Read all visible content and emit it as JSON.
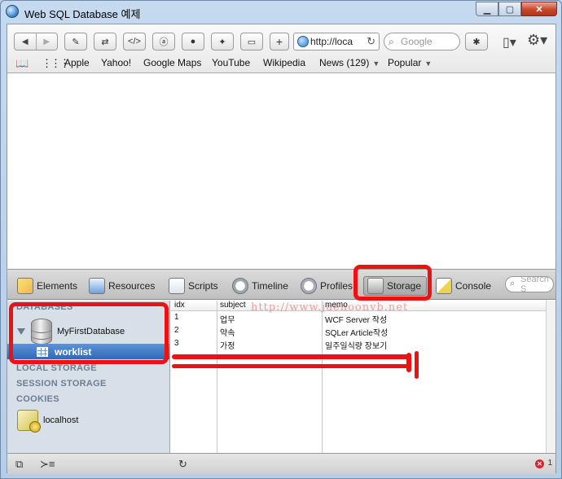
{
  "window": {
    "title": "Web SQL Database 예제"
  },
  "toolbar": {
    "url": "http://loca",
    "search_placeholder": "Google"
  },
  "bookmarks": {
    "items": [
      "Apple",
      "Yahoo!",
      "Google Maps",
      "YouTube",
      "Wikipedia"
    ],
    "news": "News (129)",
    "popular": "Popular"
  },
  "inspector": {
    "tabs": [
      "Elements",
      "Resources",
      "Scripts",
      "Timeline",
      "Profiles",
      "Storage",
      "Console"
    ],
    "active_tab": "Storage",
    "search_placeholder": "Search S"
  },
  "sidebar": {
    "databases_header": "DATABASES",
    "database_name": "MyFirstDatabase",
    "table_name": "worklist",
    "local_storage": "LOCAL STORAGE",
    "session_storage": "SESSION STORAGE",
    "cookies": "COOKIES",
    "cookie_host": "localhost"
  },
  "grid": {
    "columns": [
      "idx",
      "subject",
      "memo"
    ],
    "rows": [
      [
        "1",
        "업무",
        "WCF Server 작성"
      ],
      [
        "2",
        "약속",
        "SQLer Article작성"
      ],
      [
        "3",
        "가정",
        "일주일식량 장보기"
      ]
    ],
    "watermark": "http://www.jaehoonvb.net"
  },
  "status": {
    "error_count": "1"
  },
  "icons": [
    "back-icon",
    "forward-icon",
    "css-icon",
    "html-icon",
    "code-icon",
    "a-icon",
    "leaf-icon",
    "sparkle-icon",
    "keyboard-icon",
    "plus-icon",
    "globe-icon",
    "reload-icon",
    "search-icon",
    "bug-icon",
    "page-icon",
    "gear-icon",
    "book-icon",
    "grid-icon",
    "database-icon",
    "table-icon",
    "cookie-icon",
    "dock-icon",
    "console-prompt-icon",
    "error-icon"
  ],
  "colors": {
    "annotation": "#ee1111",
    "selection": "#3a74c4"
  }
}
